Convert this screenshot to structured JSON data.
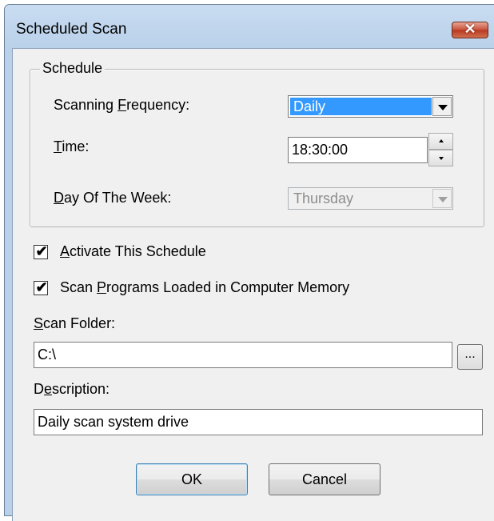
{
  "window": {
    "title": "Scheduled Scan",
    "close_label": "✕"
  },
  "schedule": {
    "group_label": "Schedule",
    "frequency_label_pre": "Scanning ",
    "frequency_label_key": "F",
    "frequency_label_post": "requency:",
    "frequency_value": "Daily",
    "time_label_key": "T",
    "time_label_post": "ime:",
    "time_value": "18:30:00",
    "day_label_key": "D",
    "day_label_post": "ay Of The Week:",
    "day_value": "Thursday",
    "day_enabled": false
  },
  "options": {
    "activate_key": "A",
    "activate_post": "ctivate This Schedule",
    "activate_checked": true,
    "scan_memory_pre": "Scan ",
    "scan_memory_key": "P",
    "scan_memory_post": "rograms Loaded in Computer Memory",
    "scan_memory_checked": true
  },
  "scan_folder": {
    "label_key": "S",
    "label_post": "can Folder:",
    "value": "C:\\",
    "browse_label": "..."
  },
  "description": {
    "label_pre": "D",
    "label_key": "e",
    "label_post": "scription:",
    "value": "Daily scan system drive"
  },
  "buttons": {
    "ok": "OK",
    "cancel": "Cancel"
  },
  "icons": {
    "checkmark": "✔"
  },
  "colors": {
    "selection": "#3399ff",
    "close_button": "#c7503a",
    "frame": "#b9d1ea"
  }
}
